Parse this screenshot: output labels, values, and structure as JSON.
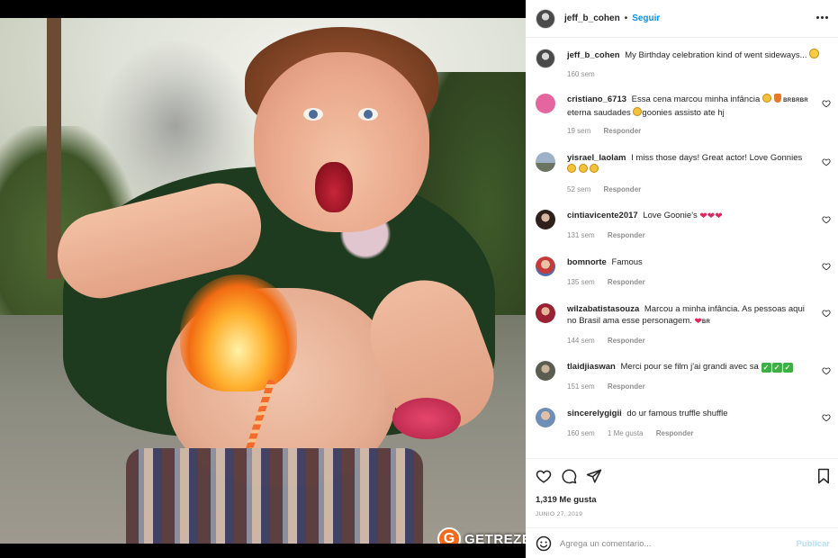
{
  "post": {
    "author": "jeff_b_cohen",
    "separator": "•",
    "follow_label": "Seguir",
    "caption": "My Birthday celebration kind of went sideways...",
    "caption_time": "160 sem",
    "likes": "1,319 Me gusta",
    "date": "JUNIO 27, 2019",
    "watermark_letter": "G",
    "watermark_text": "GETREZE"
  },
  "comments": [
    {
      "user": "cristiano_6713",
      "text_a": "Essa cena marcou minha infância",
      "text_b": "eterna saudades",
      "text_c": "goonies assisto ate hj",
      "flag": "BR",
      "time": "19 sem",
      "reply": "Responder",
      "avatar_color": "#e3679e"
    },
    {
      "user": "yisrael_laolam",
      "text": "I miss those days! Great actor! Love Gonnies",
      "time": "52 sem",
      "reply": "Responder",
      "avatar_color": "#7c8aa3"
    },
    {
      "user": "cintiavicente2017",
      "text": "Love Goonie's",
      "time": "131 sem",
      "reply": "Responder",
      "avatar_color": "#3b2b25"
    },
    {
      "user": "bomnorte",
      "text": "Famous",
      "time": "135 sem",
      "reply": "Responder",
      "avatar_color": "#c53a3a"
    },
    {
      "user": "wilzabatistasouza",
      "text": "Marcou a minha infância. As pessoas aqui no Brasil ama esse personagem.",
      "flag": "BR",
      "time": "144 sem",
      "reply": "Responder",
      "avatar_color": "#b8324f"
    },
    {
      "user": "tlaidjiaswan",
      "text": "Merci pour se film j'ai grandi avec sa",
      "time": "151 sem",
      "reply": "Responder",
      "avatar_color": "#6b6f62"
    },
    {
      "user": "sincerelygigii",
      "text": "do ur famous truffle shuffle",
      "time": "160 sem",
      "likes": "1 Me gusta",
      "reply": "Responder",
      "avatar_color": "#6f8fb6"
    }
  ],
  "add_comment": {
    "placeholder": "Agrega un comentario...",
    "publish_label": "Publicar"
  },
  "colors": {
    "accent": "#0095f6",
    "publish_disabled": "#b2dffc",
    "heart_red": "#e0245e"
  }
}
